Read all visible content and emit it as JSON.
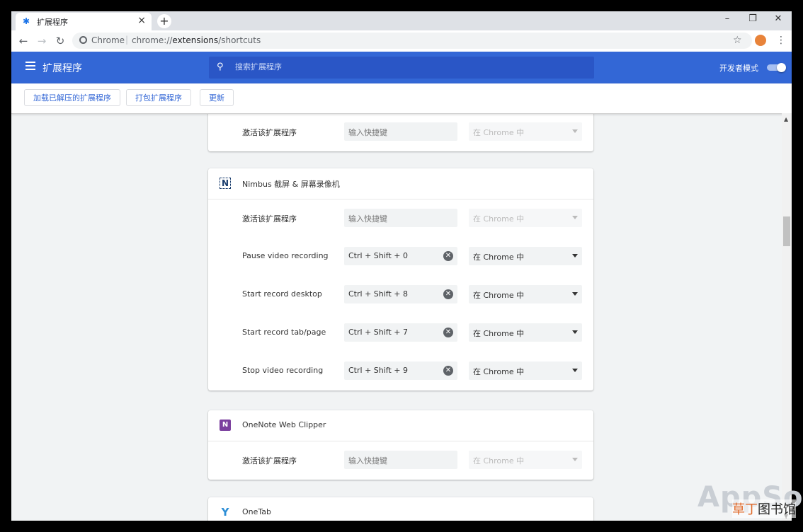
{
  "browser": {
    "tab_title": "扩展程序",
    "tab_icon": "puzzle-icon",
    "origin_label": "Chrome",
    "url_scheme": "chrome://",
    "url_host": "extensions",
    "url_path": "/shortcuts"
  },
  "header": {
    "title": "扩展程序",
    "search_placeholder": "搜索扩展程序",
    "dev_mode_label": "开发者模式",
    "dev_mode_on": true,
    "accent": "#3367d6"
  },
  "subbar": {
    "load_unpacked": "加载已解压的扩展程序",
    "pack": "打包扩展程序",
    "update": "更新"
  },
  "cards": [
    {
      "name": "",
      "rows": [
        {
          "command": "激活该扩展程序",
          "shortcut": "",
          "placeholder": "输入快捷键",
          "scope": "在 Chrome 中",
          "scope_disabled": true
        }
      ]
    },
    {
      "name": "Nimbus 截屏 & 屏幕录像机",
      "icon": "nimbus-icon",
      "rows": [
        {
          "command": "激活该扩展程序",
          "shortcut": "",
          "placeholder": "输入快捷键",
          "scope": "在 Chrome 中",
          "scope_disabled": true
        },
        {
          "command": "Pause video recording",
          "shortcut": "Ctrl + Shift + 0",
          "scope": "在 Chrome 中",
          "scope_disabled": false
        },
        {
          "command": "Start record desktop",
          "shortcut": "Ctrl + Shift + 8",
          "scope": "在 Chrome 中",
          "scope_disabled": false
        },
        {
          "command": "Start record tab/page",
          "shortcut": "Ctrl + Shift + 7",
          "scope": "在 Chrome 中",
          "scope_disabled": false
        },
        {
          "command": "Stop video recording",
          "shortcut": "Ctrl + Shift + 9",
          "scope": "在 Chrome 中",
          "scope_disabled": false
        }
      ]
    },
    {
      "name": "OneNote Web Clipper",
      "icon": "onenote-icon",
      "rows": [
        {
          "command": "激活该扩展程序",
          "shortcut": "",
          "placeholder": "输入快捷键",
          "scope": "在 Chrome 中",
          "scope_disabled": true
        }
      ]
    },
    {
      "name": "OneTab",
      "icon": "onetab-icon",
      "rows": []
    }
  ],
  "watermark": {
    "brand": "AppSo",
    "site_prefix": "草丁",
    "site_suffix": "图书馆"
  }
}
